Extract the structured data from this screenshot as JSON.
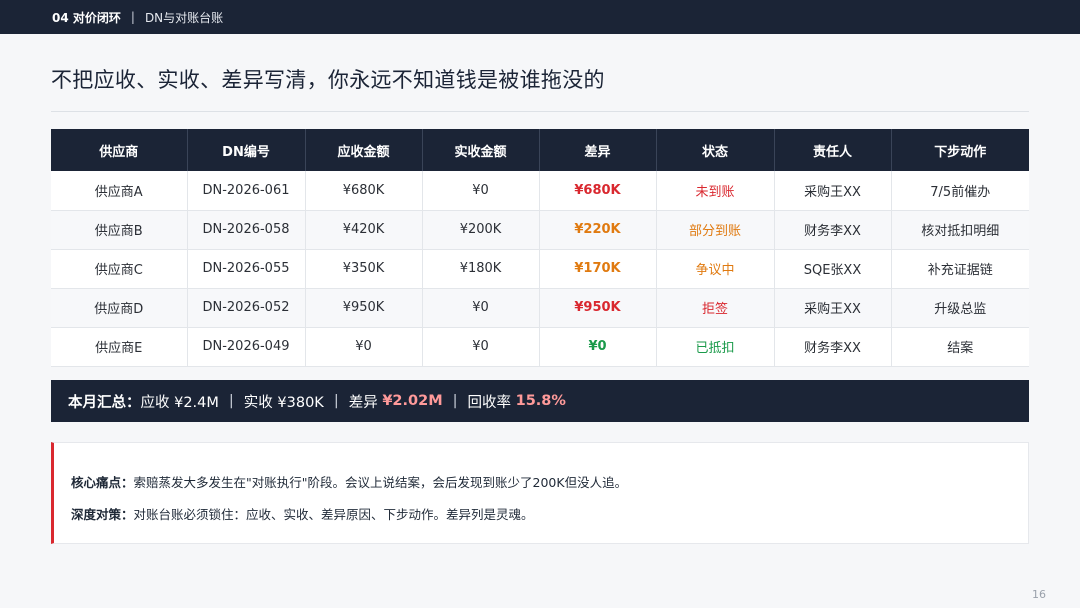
{
  "header": {
    "section": "04 对价闭环",
    "separator": "|",
    "crumb": "DN与对账台账"
  },
  "title": "不把应收、实收、差异写清，你永远不知道钱是被谁拖没的",
  "table": {
    "columns": [
      "供应商",
      "DN编号",
      "应收金额",
      "实收金额",
      "差异",
      "状态",
      "责任人",
      "下步动作"
    ],
    "rows": [
      {
        "supplier": "供应商A",
        "dn": "DN-2026-061",
        "receivable": "¥680K",
        "received": "¥0",
        "diff": "¥680K",
        "status": "未到账",
        "owner": "采购王XX",
        "next": "7/5前催办"
      },
      {
        "supplier": "供应商B",
        "dn": "DN-2026-058",
        "receivable": "¥420K",
        "received": "¥200K",
        "diff": "¥220K",
        "status": "部分到账",
        "owner": "财务李XX",
        "next": "核对抵扣明细"
      },
      {
        "supplier": "供应商C",
        "dn": "DN-2026-055",
        "receivable": "¥350K",
        "received": "¥180K",
        "diff": "¥170K",
        "status": "争议中",
        "owner": "SQE张XX",
        "next": "补充证据链"
      },
      {
        "supplier": "供应商D",
        "dn": "DN-2026-052",
        "receivable": "¥950K",
        "received": "¥0",
        "diff": "¥950K",
        "status": "拒签",
        "owner": "采购王XX",
        "next": "升级总监"
      },
      {
        "supplier": "供应商E",
        "dn": "DN-2026-049",
        "receivable": "¥0",
        "received": "¥0",
        "diff": "¥0",
        "status": "已抵扣",
        "owner": "财务李XX",
        "next": "结案"
      }
    ]
  },
  "colors": {
    "navy": "#1b2436",
    "red": "#d9282f",
    "orange": "#e07a10",
    "green": "#1a9a4a",
    "summary_highlight": "#ff9a9a"
  },
  "row_styles": [
    "red",
    "orange",
    "orange",
    "red",
    "green"
  ],
  "summary": {
    "lead": "本月汇总：",
    "receivable": "应收 ¥2.4M",
    "received": "实收 ¥380K",
    "diff_label": "差异",
    "diff_value": "¥2.02M",
    "rate_label": "回收率",
    "rate_value": "15.8%",
    "sep": "|"
  },
  "note": {
    "pain_label": "核心痛点：",
    "pain_text": "索赔蒸发大多发生在\"对账执行\"阶段。会议上说结案，会后发现到账少了200K但没人追。",
    "fix_label": "深度对策：",
    "fix_text": "对账台账必须锁住：应收、实收、差异原因、下步动作。差异列是灵魂。"
  },
  "page_number": "16"
}
